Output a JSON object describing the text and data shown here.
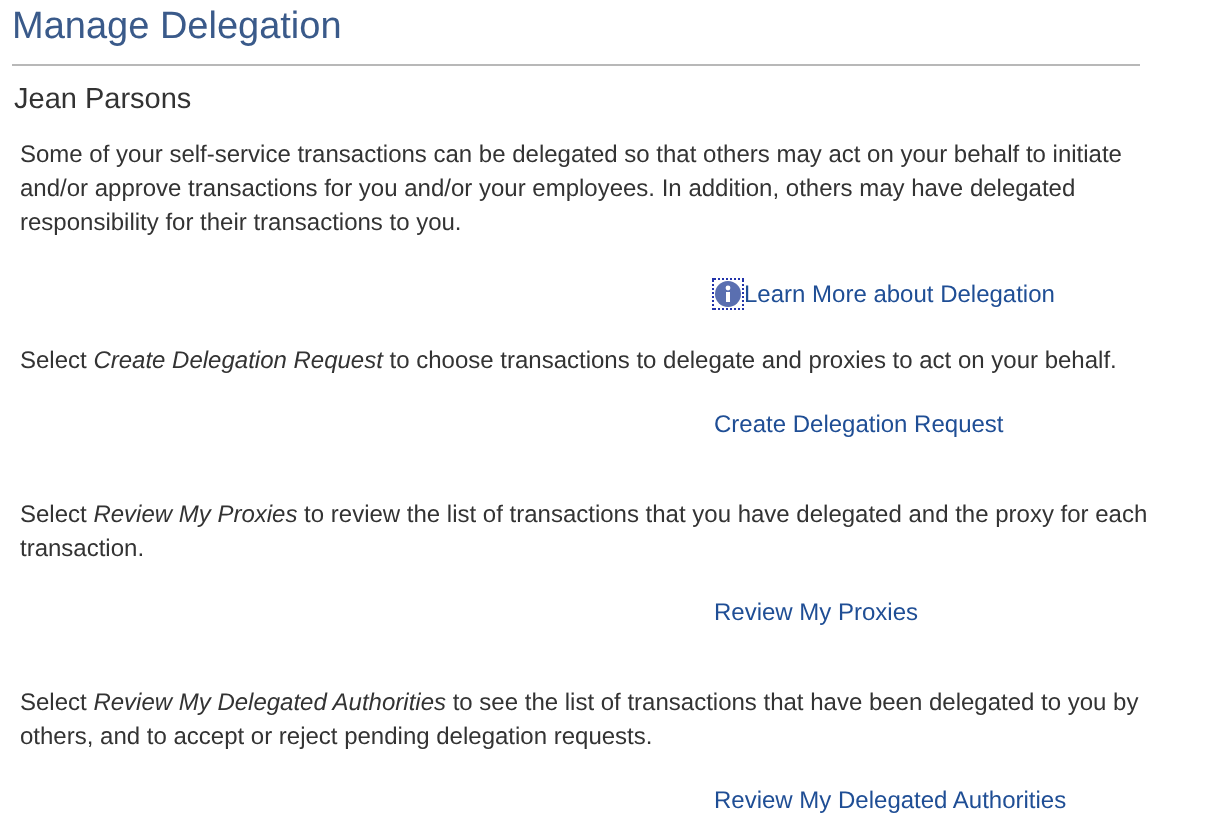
{
  "title": "Manage Delegation",
  "person_name": "Jean Parsons",
  "intro": "Some of your self-service transactions can be delegated so that others may act on your behalf to initiate and/or approve transactions for you and/or your employees. In addition, others may have delegated responsibility for their transactions to you.",
  "info_link": {
    "label": "Learn More about Delegation"
  },
  "sections": [
    {
      "text": "Select *Create Delegation Request* to choose transactions to delegate and proxies to act on your behalf.",
      "link": "Create Delegation Request"
    },
    {
      "text": "Select *Review My Proxies* to review the list of transactions that you have delegated and the proxy for each transaction.",
      "link": "Review My Proxies"
    },
    {
      "text": "Select *Review My Delegated Authorities* to see the list of transactions that have been delegated to you by others, and to accept or reject pending delegation requests.",
      "link": "Review My Delegated Authorities"
    }
  ]
}
